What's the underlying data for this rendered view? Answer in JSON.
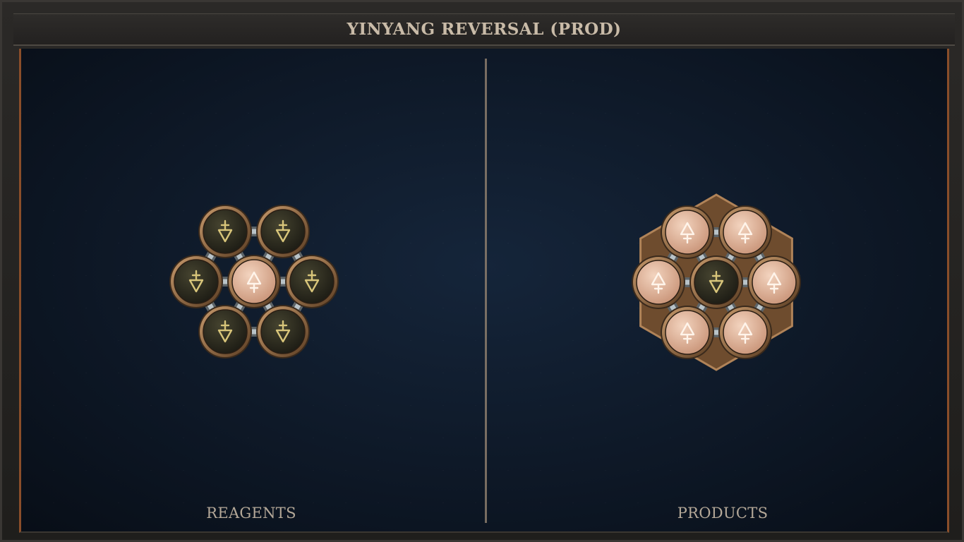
{
  "title": "YINYANG REVERSAL (PROD)",
  "panels": {
    "reagents": {
      "label": "REAGENTS"
    },
    "products": {
      "label": "PRODUCTS"
    }
  },
  "atom_types": {
    "dark": {
      "symbol_icon": "down-triangle-alchemy-icon",
      "fill": "#2c2b22",
      "rim": "#8f6a45",
      "glyph": "#d8c57a"
    },
    "light": {
      "symbol_icon": "up-triangle-alchemy-icon",
      "fill": "#e0b59a",
      "rim": "#9c7452",
      "glyph": "#fff4ea"
    }
  },
  "reagents": {
    "atoms": [
      "dark",
      "dark",
      "dark",
      "light",
      "dark",
      "dark",
      "dark"
    ]
  },
  "products": {
    "atoms": [
      "light",
      "light",
      "light",
      "dark",
      "light",
      "light",
      "light"
    ]
  }
}
